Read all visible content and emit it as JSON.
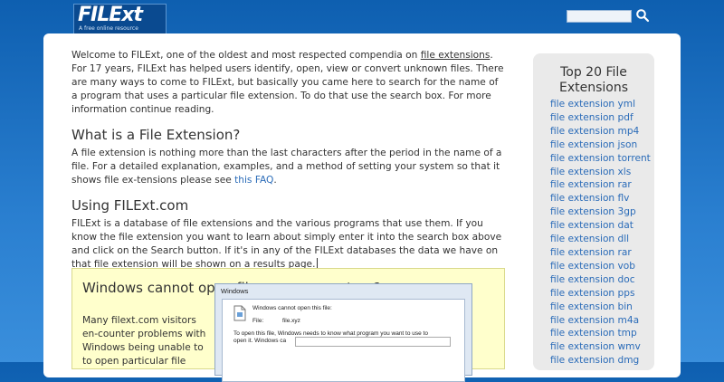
{
  "header": {
    "logo": "FILExt",
    "tagline": "A free online resource",
    "search_placeholder": ""
  },
  "intro": {
    "before_link": "Welcome to FILExt, one of the oldest and most respected compendia on ",
    "link": "file extensions",
    "after_link": ". For 17 years, FILExt has helped users identify, open, view or convert unknown files. There are many ways to come to FILExt, but basically you came here to search for the name of a program that uses a particular file extension. To do that use the search box. For more information continue reading."
  },
  "section1": {
    "heading": "What is a File Extension?",
    "text": "A file extension is nothing more than the last characters after the period in the name of a file. For a detailed explanation, examples, and a method of setting your system so that it shows file ex-tensions please see ",
    "link": "this FAQ",
    "after_link": "."
  },
  "section2": {
    "heading": "Using FILExt.com",
    "text": "FILExt is a database of file extensions and the various programs that use them. If you know the file extension you want to learn about simply enter it into the search box above and click on the Search button. If it's in any of the FILExt databases the data we have on that file extension will be shown on a results page."
  },
  "promo": {
    "heading": "Windows cannot open files on your system?",
    "text": "Many filext.com visitors en-counter problems with Windows being unable to to open particular file",
    "dialog": {
      "title": "Windows",
      "message": "Windows cannot open this file:",
      "file_label": "File:",
      "file_value": "file.xyz",
      "line1": "To open this file, Windows needs to know what program you want to use to",
      "line2": "open it.  Windows ca"
    }
  },
  "sidebar": {
    "title": "Top 20 File Extensions",
    "items": [
      "file extension yml",
      "file extension pdf",
      "file extension mp4",
      "file extension json",
      "file extension torrent",
      "file extension xls",
      "file extension rar",
      "file extension flv",
      "file extension 3gp",
      "file extension dat",
      "file extension dll",
      "file extension rar",
      "file extension vob",
      "file extension doc",
      "file extension pps",
      "file extension bin",
      "file extension m4a",
      "file extension tmp",
      "file extension wmv",
      "file extension dmg"
    ]
  },
  "colors": {
    "link": "#2a6bb8",
    "header_bg": "#0e5fb0",
    "promo_bg": "#ffffcc"
  }
}
